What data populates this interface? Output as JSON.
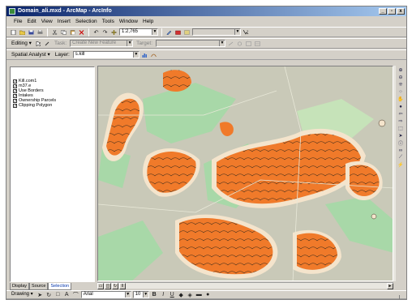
{
  "window": {
    "title": "Domain_ali.mxd - ArcMap - ArcInfo",
    "min_label": "_",
    "max_label": "▫",
    "close_label": "x"
  },
  "menu": [
    "File",
    "Edit",
    "View",
    "Insert",
    "Selection",
    "Tools",
    "Window",
    "Help"
  ],
  "standard_toolbar": {
    "scale_value": "1:2,765",
    "tool_labels": [
      "↶",
      "↷"
    ]
  },
  "editor_toolbar": {
    "editor_label": "Editing ▾",
    "task_label": "Task:",
    "task_value": "Create New Feature",
    "target_label": "Target:",
    "target_value": ""
  },
  "spatial_toolbar": {
    "menu_label": "Spatial Analyst ▾",
    "layer_label": "Layer:",
    "layer_value": "s.kill"
  },
  "toc": {
    "layers": [
      {
        "label": "Kill.com1",
        "checked": true
      },
      {
        "label": "m37.e",
        "checked": true
      },
      {
        "label": "Use Borders",
        "checked": true
      },
      {
        "label": "Intakes",
        "checked": true
      },
      {
        "label": "Ownership Parcels",
        "checked": true
      },
      {
        "label": "Clipping Polygon",
        "checked": true
      }
    ],
    "tabs": [
      "Display",
      "Source",
      "Selection"
    ],
    "active_tab": 2
  },
  "drawing_toolbar": {
    "drawing_label": "Drawing ▾",
    "font_value": "Arial",
    "size_value": "10",
    "bold_label": "B",
    "italic_label": "I",
    "underline_label": "U",
    "text_tool_label": "A"
  },
  "colors": {
    "map_background": "#c9c9b8",
    "green_zone": "#a8d8a8",
    "light_green_zone": "#c6e3b9",
    "orange_fill": "#f07a2a",
    "pale_buffer": "#f4e4cc",
    "contour_stroke": "#3a2a1a",
    "title_gradient_start": "#0a246a"
  }
}
